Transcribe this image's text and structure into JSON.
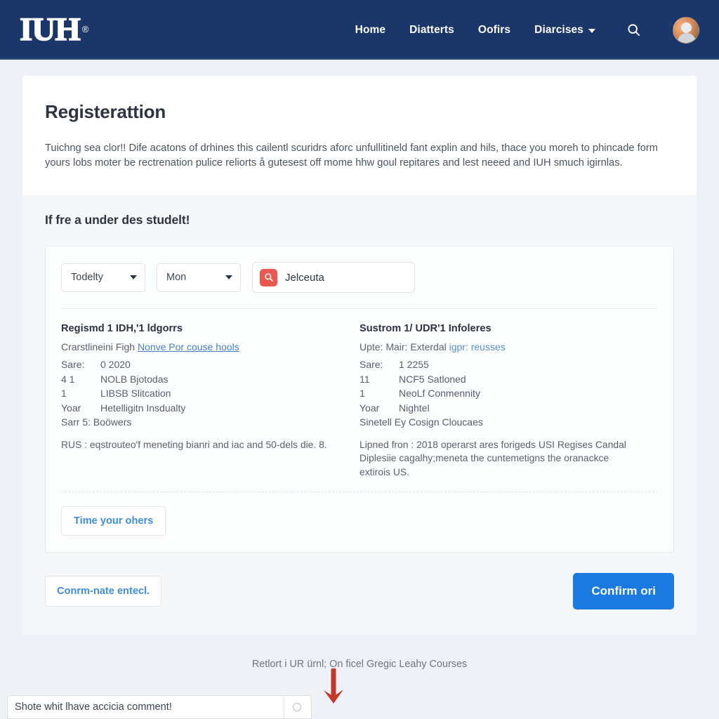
{
  "header": {
    "logo_text": "IUH",
    "logo_mark": "®",
    "nav": [
      {
        "label": "Home",
        "has_caret": false
      },
      {
        "label": "Diatterts",
        "has_caret": false
      },
      {
        "label": "Oofirs",
        "has_caret": false
      },
      {
        "label": "Diarcises",
        "has_caret": true
      }
    ],
    "search_icon": "search-icon",
    "avatar": "user-avatar",
    "bar_color": "#1b3668"
  },
  "main": {
    "title": "Registerattion",
    "intro": "Tuichng sea clor!! Dife acatons of drhines this cailentl scuridrs aforc unfullitineld fant explin and hils, thace you moreh to phincade form yours lobs moter be rectrenation pulice reliorts å gutesest off mome hhw goul repitares and lest neeed and IUH smuch igirnlas.",
    "section_heading": "If fre a under des studelt!"
  },
  "filters": {
    "select_one": {
      "value": "Todelty"
    },
    "select_two": {
      "value": "Mon"
    },
    "search": {
      "value": "Jelceuta",
      "placeholder": "Jelceuta",
      "icon_color": "#e8584e"
    }
  },
  "columns": [
    {
      "title": "Regismd 1 IDH,'1 ldgorrs",
      "subline_prefix": "Crarstlineini Figh ",
      "subline_link": "Nonve Por couse hools",
      "rows": [
        {
          "k": "Sare:",
          "v": "0 2020"
        },
        {
          "k": "4 1",
          "v": "NOLB Bjotodas"
        },
        {
          "k": "1",
          "v": "LIBSB Slitcation"
        },
        {
          "k": "Yoar",
          "v": "Hetelligitn Insdualty"
        }
      ],
      "single_line": "Sarr 5: Boöwers",
      "note": "RUS : eqstrouteo'f meneting bianri and iac and 50-dels die. 8."
    },
    {
      "title": "Sustrom 1/ UDR'1 Infoleres",
      "subline_prefix": "Upte: Mair: Exterdal ",
      "subline_link": "igpr: reusses",
      "rows": [
        {
          "k": "Sare:",
          "v": "1 2255"
        },
        {
          "k": "11",
          "v": "NCF5 Satloned"
        },
        {
          "k": "1",
          "v": "NeoLf Conmennity"
        },
        {
          "k": "Yoar",
          "v": "Nightel"
        }
      ],
      "single_line": "Sinetell Ey Cosign Cloucaes",
      "note": "Lipned fron : 2018 operarst ares forigeds USI Regises Candal Diplesiie cagalhy;meneta the cuntemetigns the oranackce extirois US."
    }
  ],
  "buttons": {
    "add_more": "Time your ohers",
    "cancel": "Conrm-nate entecl.",
    "confirm": "Confirm ori",
    "primary_color": "#1a7ae0"
  },
  "footer": {
    "text": "Retlort i UR ürnl; On ficel Gregic Leahy Courses"
  },
  "chatbar": {
    "text": "Shote whit lhave accicia comment!",
    "spinner": "loading-spinner-icon"
  },
  "annotation": {
    "arrow": "red-down-arrow",
    "color": "#c0392b"
  }
}
